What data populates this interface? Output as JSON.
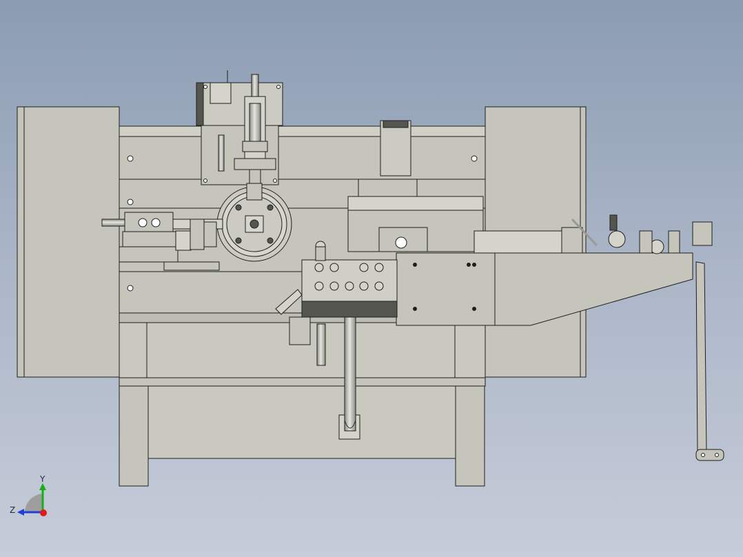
{
  "viewport": {
    "background_top": "#8b9cb2",
    "background_bottom": "#c6ccd9",
    "model_fill": "#c5c5bc",
    "model_fill_light": "#d2d2ca",
    "model_fill_dark": "#a9a9a1",
    "panel_dark": "#55554f",
    "edge_color": "#1e1e1e"
  },
  "triad": {
    "y_label": "Y",
    "z_label": "Z",
    "y_axis_color": "#16b016",
    "z_axis_color": "#1f3fd8",
    "x_axis_color": "#e01b1b"
  }
}
